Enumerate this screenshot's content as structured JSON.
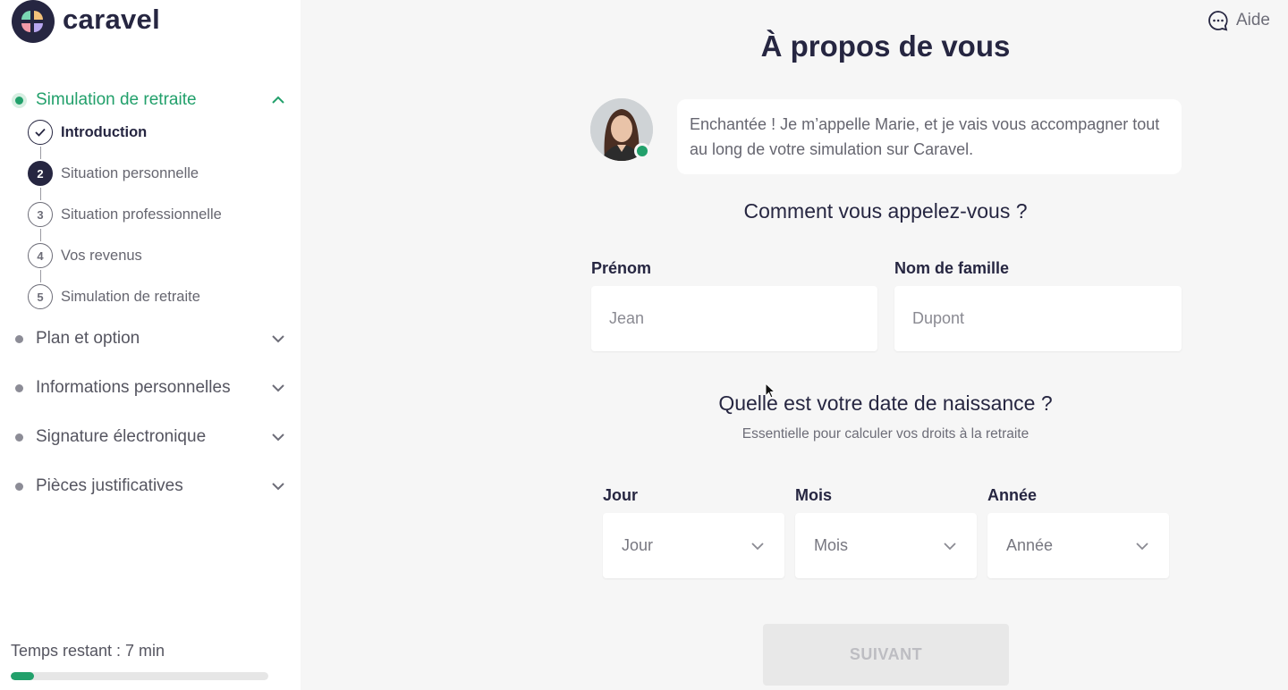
{
  "brand": {
    "name": "caravel"
  },
  "help": {
    "label": "Aide"
  },
  "sidebar": {
    "sections": [
      {
        "label": "Simulation de retraite",
        "state": "expanded"
      },
      {
        "label": "Plan et option",
        "state": "collapsed"
      },
      {
        "label": "Informations personnelles",
        "state": "collapsed"
      },
      {
        "label": "Signature électronique",
        "state": "collapsed"
      },
      {
        "label": "Pièces justificatives",
        "state": "collapsed"
      }
    ],
    "steps": [
      {
        "number": "",
        "label": "Introduction",
        "status": "done"
      },
      {
        "number": "2",
        "label": "Situation personnelle",
        "status": "current"
      },
      {
        "number": "3",
        "label": "Situation professionnelle",
        "status": "todo"
      },
      {
        "number": "4",
        "label": "Vos revenus",
        "status": "todo"
      },
      {
        "number": "5",
        "label": "Simulation de retraite",
        "status": "todo"
      }
    ],
    "remaining": "Temps restant : 7 min",
    "progress": 0.09
  },
  "main": {
    "title": "À propos de vous",
    "assistant_message": "Enchantée ! Je m’appelle Marie, et je vais vous accompagner tout au long de votre simulation sur Caravel.",
    "name_question": "Comment vous appelez-vous ?",
    "first_name": {
      "label": "Prénom",
      "placeholder": "Jean"
    },
    "last_name": {
      "label": "Nom de famille",
      "placeholder": "Dupont"
    },
    "birth_question": "Quelle est votre date de naissance ?",
    "birth_subtitle": "Essentielle pour calculer vos droits à la retraite",
    "day": {
      "label": "Jour",
      "value": "Jour"
    },
    "month": {
      "label": "Mois",
      "value": "Mois"
    },
    "year": {
      "label": "Année",
      "value": "Année"
    },
    "next_label": "SUIVANT"
  },
  "colors": {
    "accent": "#22a06b",
    "navy": "#262641",
    "background": "#f6f6f6"
  }
}
